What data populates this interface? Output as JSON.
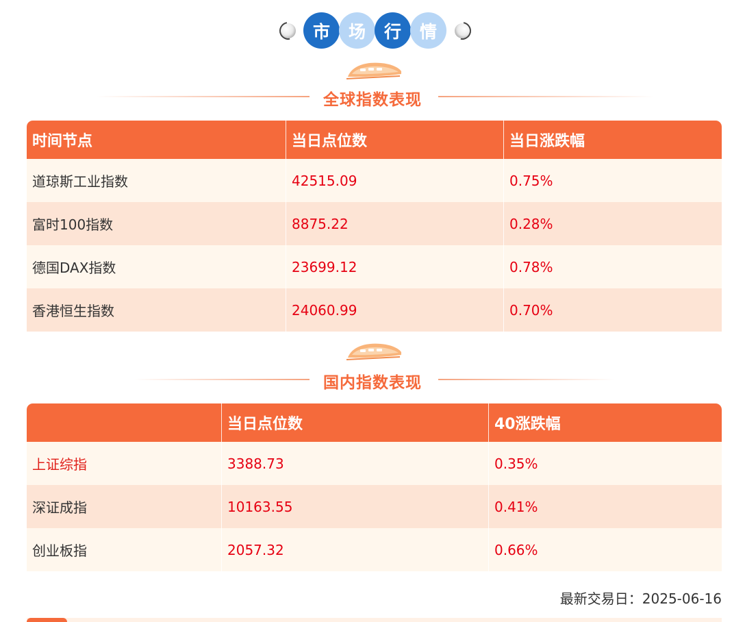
{
  "banner": {
    "chars": [
      "市",
      "场",
      "行",
      "情"
    ]
  },
  "global": {
    "title": "全球指数表现",
    "headers": [
      "时间节点",
      "当日点位数",
      "当日涨跌幅"
    ],
    "rows": [
      [
        "道琼斯工业指数",
        "42515.09",
        "0.75%"
      ],
      [
        "富时100指数",
        "8875.22",
        "0.28%"
      ],
      [
        "德国DAX指数",
        "23699.12",
        "0.78%"
      ],
      [
        "香港恒生指数",
        "24060.99",
        "0.70%"
      ]
    ]
  },
  "domestic": {
    "title": "国内指数表现",
    "headers": [
      "",
      "当日点位数",
      "40涨跌幅"
    ],
    "rows": [
      [
        "上证综指",
        "3388.73",
        "0.35%"
      ],
      [
        "深证成指",
        "10163.55",
        "0.41%"
      ],
      [
        "创业板指",
        "2057.32",
        "0.66%"
      ]
    ]
  },
  "footer": {
    "latest_trading_day": "最新交易日：2025-06-16"
  },
  "colors": {
    "accent": "#f56a3b",
    "row_light": "#fff7ed",
    "row_dark": "#fde4d5",
    "value_red": "#e60012",
    "banner_blue": "#1f6fc6",
    "banner_light_blue": "#b7d6f6"
  },
  "icons": [
    "ball-icon",
    "train-icon"
  ]
}
